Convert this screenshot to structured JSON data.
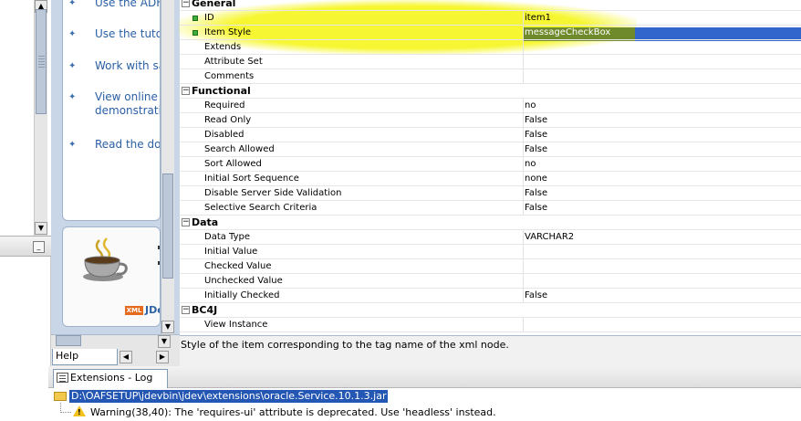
{
  "help_links": [
    {
      "label": "Use the ADF"
    },
    {
      "label": "Use the tutor"
    },
    {
      "label": "Work with sa"
    },
    {
      "label": "View online"
    },
    {
      "label": "demonstrati"
    },
    {
      "label": "Read the doc"
    }
  ],
  "help_card": {
    "xml_badge": "XML",
    "brand": "JDe"
  },
  "help_tab": {
    "label": "Help Content"
  },
  "properties": {
    "categories": [
      {
        "name": "General",
        "toggle": "−",
        "rows": [
          {
            "name": "ID",
            "value": "item1"
          },
          {
            "name": "Item Style",
            "value": "messageCheckBox"
          },
          {
            "name": "Extends",
            "value": ""
          },
          {
            "name": "Attribute Set",
            "value": ""
          },
          {
            "name": "Comments",
            "value": ""
          }
        ]
      },
      {
        "name": "Functional",
        "toggle": "−",
        "rows": [
          {
            "name": "Required",
            "value": "no"
          },
          {
            "name": "Read Only",
            "value": "False"
          },
          {
            "name": "Disabled",
            "value": "False"
          },
          {
            "name": "Search Allowed",
            "value": "False"
          },
          {
            "name": "Sort Allowed",
            "value": "no"
          },
          {
            "name": "Initial Sort Sequence",
            "value": "none"
          },
          {
            "name": "Disable Server Side Validation",
            "value": "False"
          },
          {
            "name": "Selective Search Criteria",
            "value": "False"
          }
        ]
      },
      {
        "name": "Data",
        "toggle": "−",
        "rows": [
          {
            "name": "Data Type",
            "value": "VARCHAR2"
          },
          {
            "name": "Initial Value",
            "value": ""
          },
          {
            "name": "Checked Value",
            "value": ""
          },
          {
            "name": "Unchecked Value",
            "value": ""
          },
          {
            "name": "Initially Checked",
            "value": "False"
          }
        ]
      },
      {
        "name": "BC4J",
        "toggle": "−",
        "rows": [
          {
            "name": "View Instance",
            "value": ""
          }
        ]
      }
    ],
    "description": "Style of the item corresponding to the tag name of the xml node."
  },
  "log": {
    "tab_label": "Extensions - Log",
    "path": "D:\\OAFSETUP\\jdevbin\\jdev\\extensions\\oracle.Service.10.1.3.jar",
    "warning": "Warning(38,40): The 'requires-ui' attribute is deprecated. Use 'headless' instead."
  },
  "colors": {
    "highlight": "#f6f628",
    "selection": "#3266cc",
    "panel_bg": "#c9d6e8",
    "link": "#2a5fa5"
  }
}
